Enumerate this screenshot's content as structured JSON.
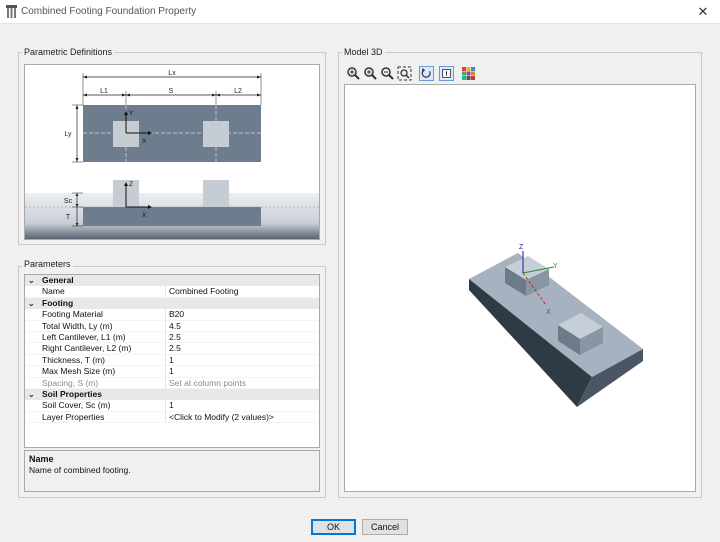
{
  "window": {
    "title": "Combined Footing Foundation Property",
    "close_glyph": "✕"
  },
  "parametric": {
    "label": "Parametric Definitions",
    "dims": {
      "lx": "Lx",
      "l1": "L1",
      "s": "S",
      "l2": "L2",
      "ly": "Ly",
      "sc": "Sc",
      "t": "T"
    },
    "axes": {
      "x": "X",
      "y": "Y",
      "z": "Z"
    }
  },
  "model3d": {
    "label": "Model 3D",
    "toolbar": [
      "zoom-in-icon",
      "zoom-in-plus-icon",
      "zoom-out-icon",
      "zoom-extents-icon",
      "rotate-icon",
      "view-icon",
      "palette-icon"
    ],
    "axes": {
      "x": "X",
      "y": "Y",
      "z": "Z"
    }
  },
  "parameters": {
    "label": "Parameters",
    "categories": [
      {
        "name": "General",
        "rows": [
          {
            "name": "Name",
            "value": "Combined Footing",
            "disabled": false
          }
        ]
      },
      {
        "name": "Footing",
        "rows": [
          {
            "name": "Footing Material",
            "value": "B20",
            "disabled": false
          },
          {
            "name": "Total Width, Ly (m)",
            "value": "4.5",
            "disabled": false
          },
          {
            "name": "Left Cantilever, L1 (m)",
            "value": "2.5",
            "disabled": false
          },
          {
            "name": "Right Cantilever, L2 (m)",
            "value": "2.5",
            "disabled": false
          },
          {
            "name": "Thickness, T (m)",
            "value": "1",
            "disabled": false
          },
          {
            "name": "Max Mesh Size (m)",
            "value": "1",
            "disabled": false
          },
          {
            "name": "Spacing, S (m)",
            "value": "Set at column points",
            "disabled": true
          }
        ]
      },
      {
        "name": "Soil Properties",
        "rows": [
          {
            "name": "Soil Cover, Sc (m)",
            "value": "1",
            "disabled": false
          },
          {
            "name": "Layer Properties",
            "value": "<Click to Modify (2 values)>",
            "disabled": false
          }
        ]
      }
    ]
  },
  "description": {
    "title": "Name",
    "text": "Name of combined footing."
  },
  "buttons": {
    "ok": "OK",
    "cancel": "Cancel"
  }
}
